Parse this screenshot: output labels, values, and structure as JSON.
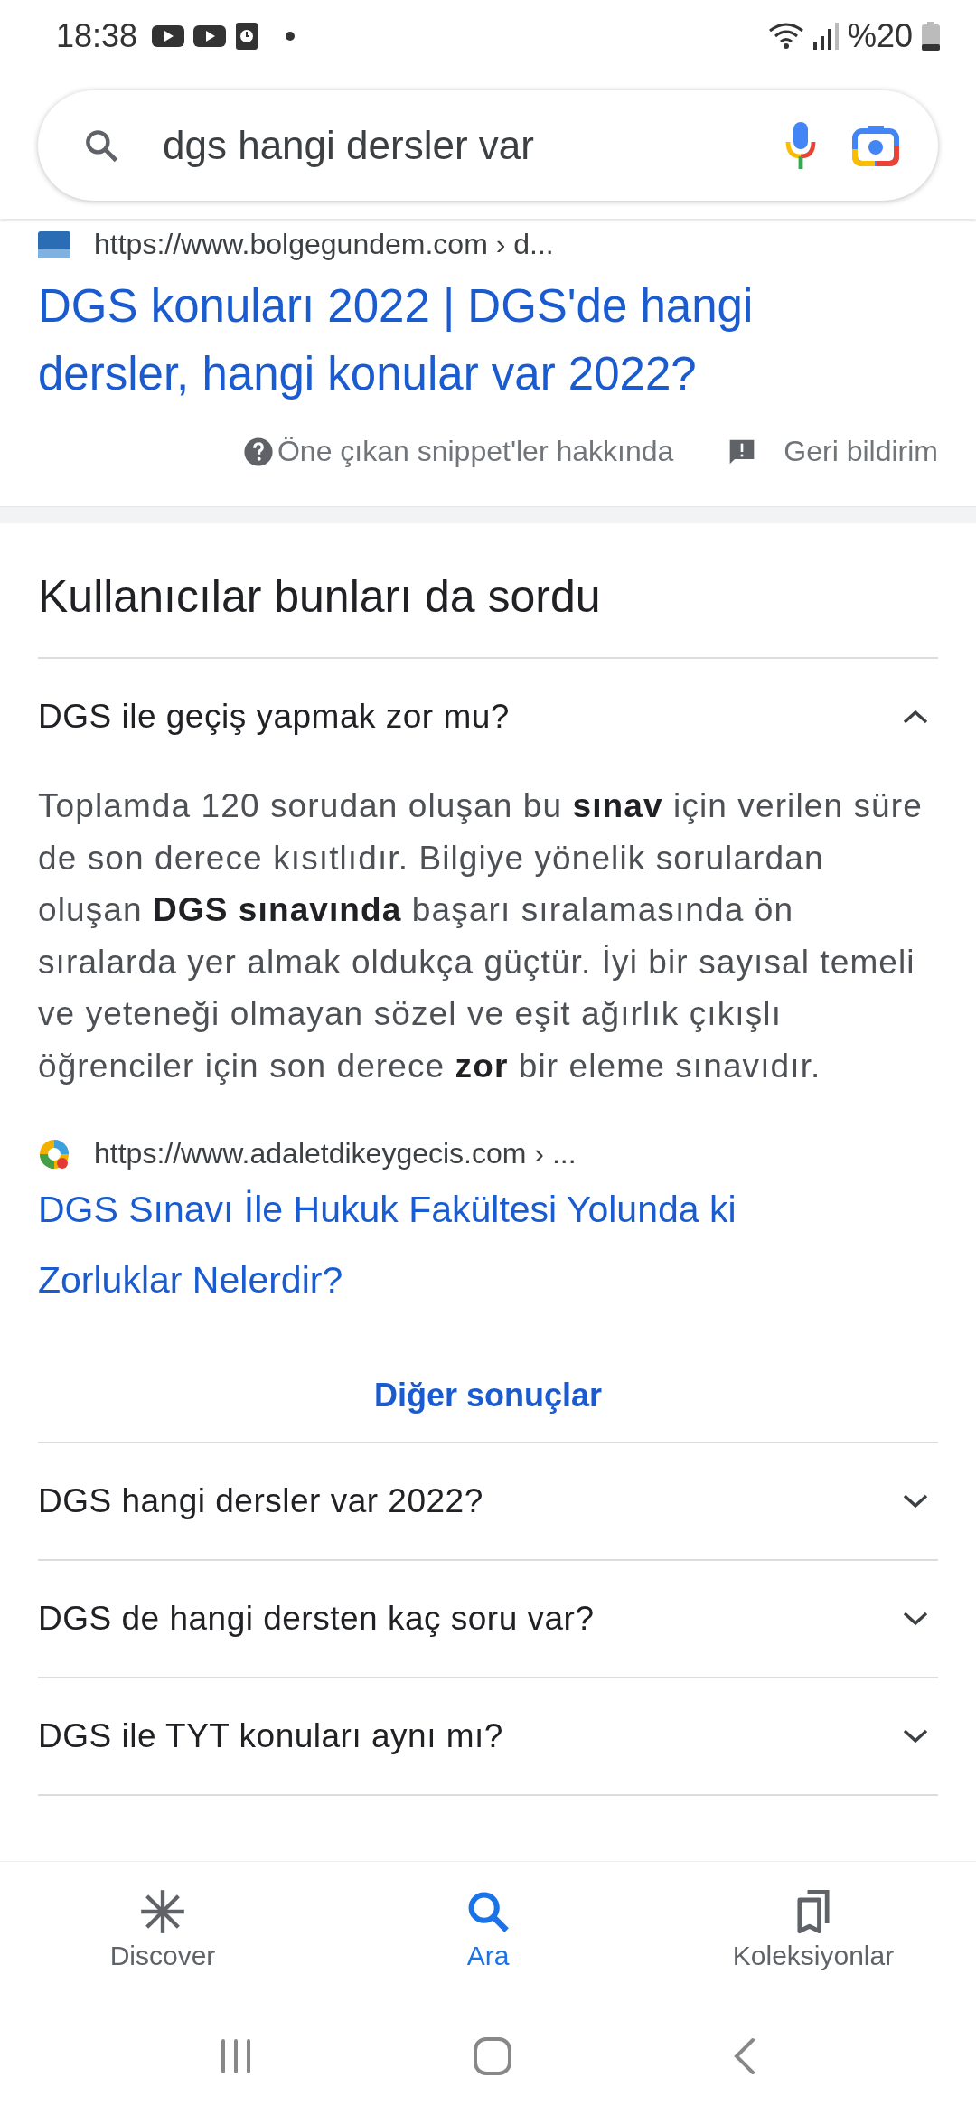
{
  "status_bar": {
    "time": "18:38",
    "battery": "%20"
  },
  "search": {
    "value": "dgs hangi dersler var"
  },
  "top_result": {
    "url": "https://www.bolgegundem.com › d...",
    "title": "DGS konuları 2022 | DGS'de hangi dersler, hangi konular var 2022?",
    "about": "Öne çıkan snippet'ler hakkında",
    "feedback": "Geri bildirim"
  },
  "people_also_ask": {
    "heading": "Kullanıcılar bunları da sordu",
    "questions": [
      {
        "question": "DGS ile geçiş yapmak zor mu?",
        "expanded": true,
        "answer": "Toplamda 120 sorudan oluşan bu **sınav** için verilen süre de son derece kısıtlıdır. Bilgiye yönelik sorulardan oluşan **DGS sınavında** başarı sıralamasında ön sıralarda yer almak oldukça güçtür. İyi bir sayısal temeli ve yeteneği olmayan sözel ve eşit ağırlık çıkışlı öğrenciler için son derece **zor** bir eleme sınavıdır.",
        "source_url": "https://www.adaletdikeygecis.com › ...",
        "source_title": "DGS Sınavı İle Hukuk Fakültesi Yolunda ki Zorluklar Nelerdir?",
        "more": "Diğer sonuçlar"
      },
      {
        "question": "DGS hangi dersler var 2022?",
        "expanded": false
      },
      {
        "question": "DGS de hangi dersten kaç soru var?",
        "expanded": false
      },
      {
        "question": "DGS ile TYT konuları aynı mı?",
        "expanded": false
      }
    ]
  },
  "bottom_nav": [
    {
      "label": "Discover",
      "selected": false
    },
    {
      "label": "Ara",
      "selected": true
    },
    {
      "label": "Koleksiyonlar",
      "selected": false
    }
  ]
}
